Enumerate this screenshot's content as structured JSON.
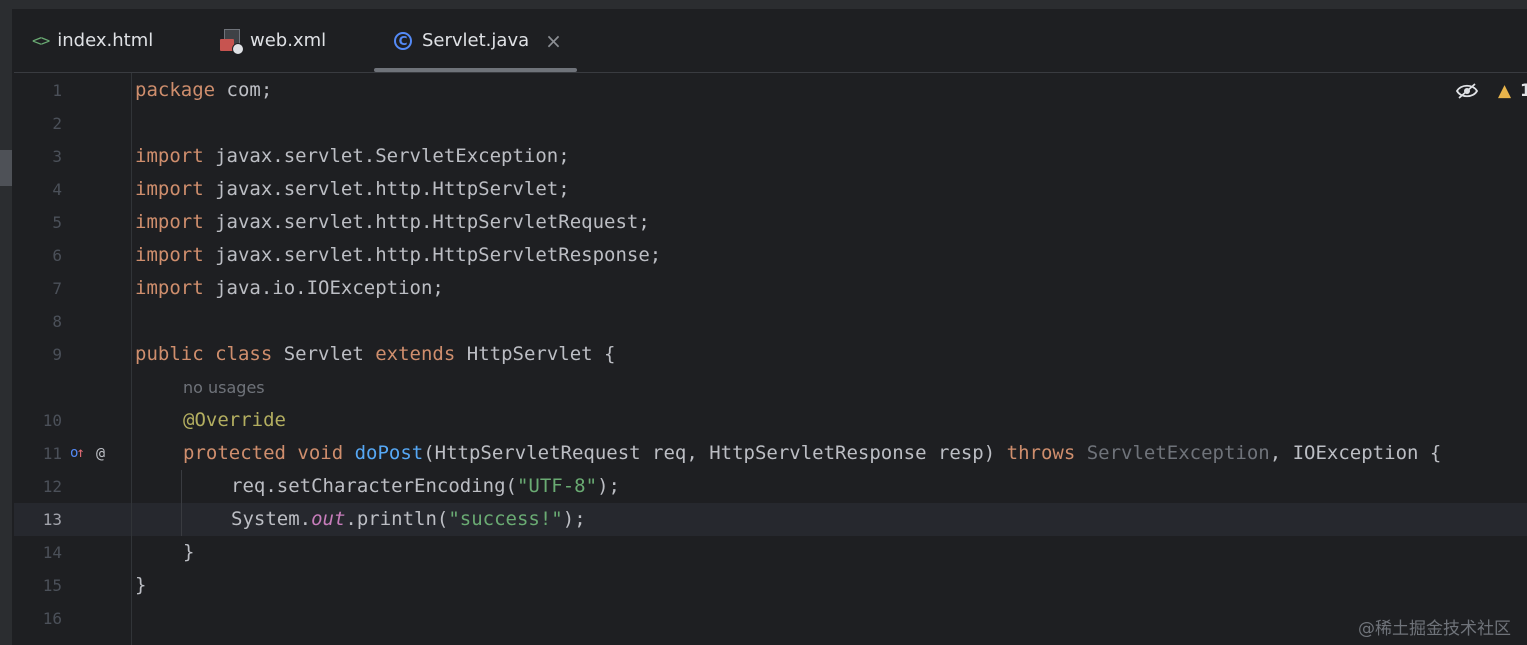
{
  "tabs": [
    {
      "label": "index.html",
      "icon": "html-file-icon"
    },
    {
      "label": "web.xml",
      "icon": "xml-file-icon"
    },
    {
      "label": "Servlet.java",
      "icon": "java-class-icon",
      "active": true,
      "close": "×"
    }
  ],
  "editor": {
    "warning_count": "1",
    "lines": [
      {
        "n": "1"
      },
      {
        "n": "2"
      },
      {
        "n": "3"
      },
      {
        "n": "4"
      },
      {
        "n": "5"
      },
      {
        "n": "6"
      },
      {
        "n": "7"
      },
      {
        "n": "8"
      },
      {
        "n": "9"
      },
      {
        "n": "10"
      },
      {
        "n": "11"
      },
      {
        "n": "12"
      },
      {
        "n": "13"
      },
      {
        "n": "14"
      },
      {
        "n": "15"
      },
      {
        "n": "16"
      }
    ],
    "code": {
      "l1_kw": "package",
      "l1_rest": " com;",
      "l3_kw": "import",
      "l3_rest": " javax.servlet.ServletException;",
      "l4_kw": "import",
      "l4_rest": " javax.servlet.http.HttpServlet;",
      "l5_kw": "import",
      "l5_rest": " javax.servlet.http.HttpServletRequest;",
      "l6_kw": "import",
      "l6_rest": " javax.servlet.http.HttpServletResponse;",
      "l7_kw": "import",
      "l7_rest": " java.io.IOException;",
      "l9_kw1": "public class",
      "l9_a": " Servlet ",
      "l9_kw2": "extends",
      "l9_b": " HttpServlet {",
      "hint": "no usages",
      "l10_ann": "@Override",
      "l11_kw": "protected void ",
      "l11_fn": "doPost",
      "l11_a": "(HttpServletRequest req, HttpServletResponse resp) ",
      "l11_kw2": "throws ",
      "l11_gray": "ServletException",
      "l11_b": ", IOException {",
      "l12_a": "req.setCharacterEncoding(",
      "l12_str": "\"UTF-8\"",
      "l12_b": ");",
      "l13_a": "System.",
      "l13_static": "out",
      "l13_b": ".println(",
      "l13_str": "\"success!\"",
      "l13_c": ");",
      "l14": "}",
      "l15": "}"
    },
    "gutter_marks": {
      "override": "o",
      "override_arrow": "↑",
      "at": "@"
    },
    "current_line": "13"
  },
  "watermark": "@稀土掘金技术社区",
  "colors": {
    "background": "#1e1f22",
    "keyword": "#cf8e6d",
    "annotation": "#b3ae60",
    "function": "#56a8f5",
    "string": "#6aab73",
    "static_field": "#c77dbb"
  }
}
